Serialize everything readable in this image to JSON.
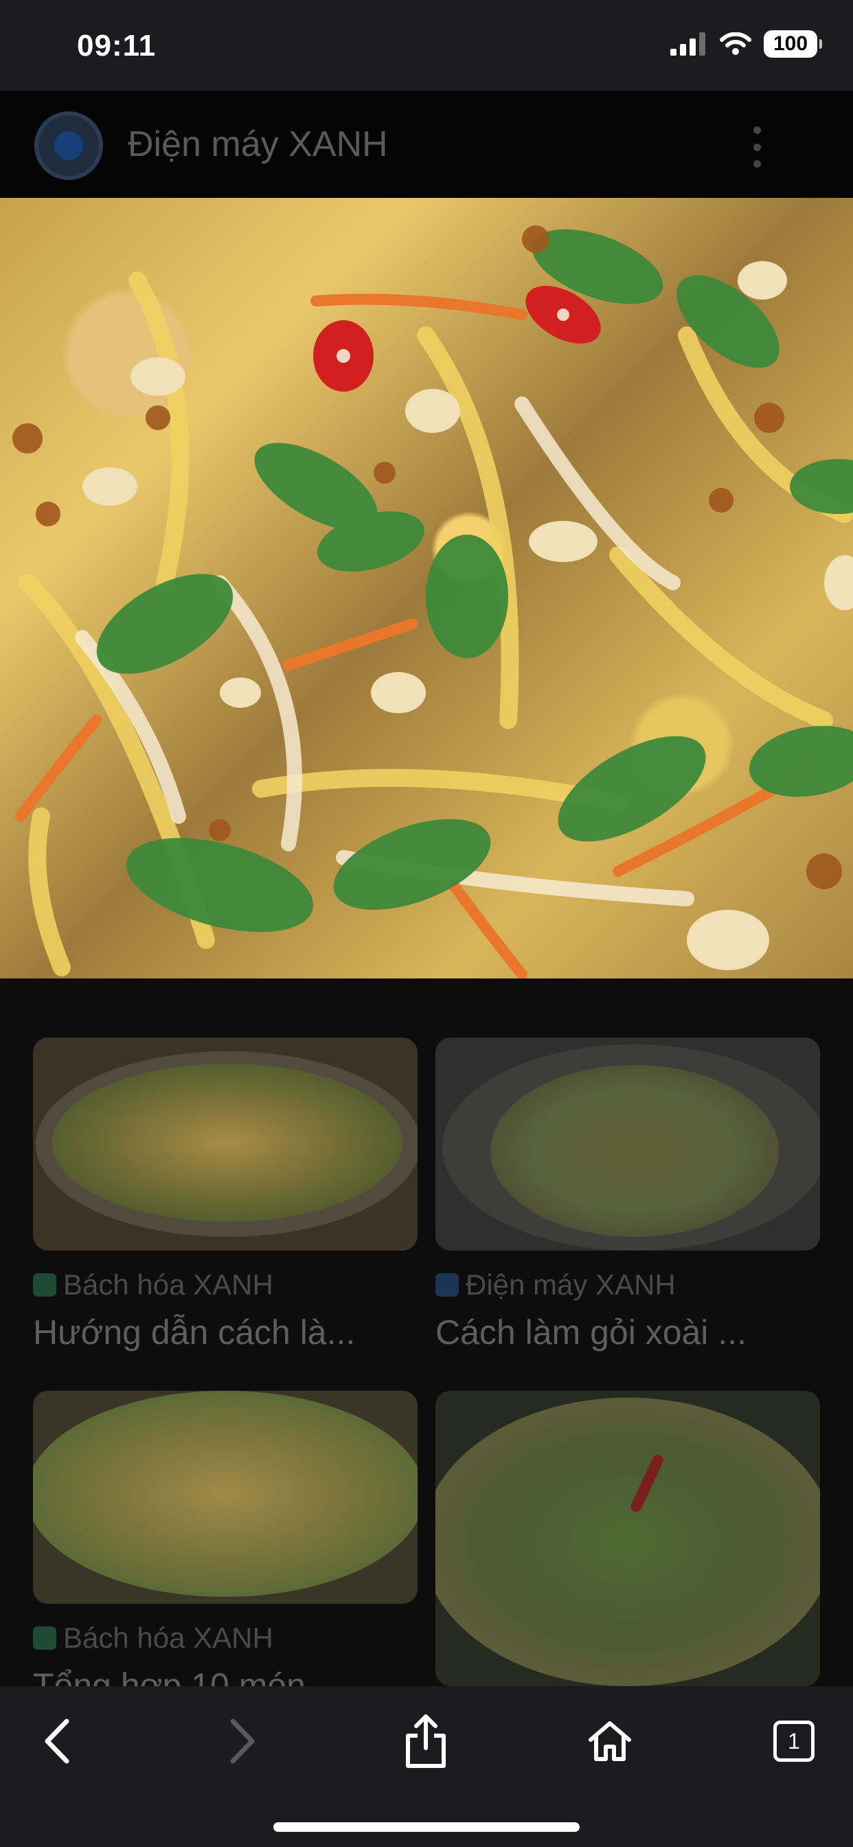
{
  "status_bar": {
    "time": "09:11",
    "battery": "100",
    "icons": [
      "cellular-signal-icon",
      "wifi-icon",
      "battery-icon"
    ]
  },
  "header": {
    "site_name": "Điện máy XANH",
    "icons": [
      "site-logo-icon",
      "more-vertical-icon"
    ]
  },
  "hero": {
    "image": "green-mango-salad-photo"
  },
  "results": [
    {
      "source": "Bách hóa XANH",
      "title": "Hướng dẫn cách là...",
      "favicon_color": "#1f4a34"
    },
    {
      "source": "Điện máy XANH",
      "title": "Cách làm gỏi xoài ...",
      "favicon_color": "#1d3454"
    },
    {
      "source": "Bách hóa XANH",
      "title": "Tổng hợp 10 món",
      "favicon_color": "#1f4a34"
    },
    {
      "source": "",
      "title": "",
      "favicon_color": ""
    }
  ],
  "toolbar": {
    "tabs_count": "1",
    "icons": [
      "back-icon",
      "forward-icon",
      "share-icon",
      "home-icon",
      "tabs-icon"
    ]
  },
  "colors": {
    "background": "#0d0d0d",
    "chrome": "#1c1c1e",
    "disabled_icon": "#5a5a5a"
  }
}
